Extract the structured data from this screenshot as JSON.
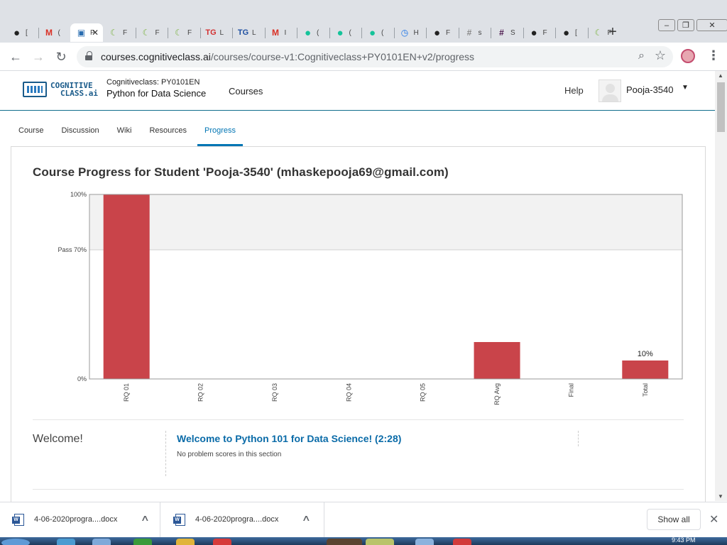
{
  "browser": {
    "tabs": [
      {
        "icon": "github-icon",
        "title": "[",
        "color": "#222"
      },
      {
        "icon": "gmail-icon",
        "title": "(",
        "color": "#d93025"
      },
      {
        "icon": "cognitiveclass-icon",
        "title": "P",
        "color": "#2a6db0",
        "active": true
      },
      {
        "icon": "moon-icon",
        "title": "F",
        "color": "#7cb342"
      },
      {
        "icon": "moon-icon",
        "title": "F",
        "color": "#7cb342"
      },
      {
        "icon": "moon-icon",
        "title": "F",
        "color": "#7cb342"
      },
      {
        "icon": "tg-icon",
        "title": "L",
        "color": "#d32f2f"
      },
      {
        "icon": "tg-icon",
        "title": "L",
        "color": "#1e4fa1"
      },
      {
        "icon": "gmail-icon",
        "title": "I",
        "color": "#d93025"
      },
      {
        "icon": "grammarly-icon",
        "title": "(",
        "color": "#15c39a"
      },
      {
        "icon": "grammarly-icon",
        "title": "(",
        "color": "#15c39a"
      },
      {
        "icon": "grammarly-icon",
        "title": "(",
        "color": "#15c39a"
      },
      {
        "icon": "history-icon",
        "title": "H",
        "color": "#1a73e8"
      },
      {
        "icon": "github-icon",
        "title": "F",
        "color": "#222"
      },
      {
        "icon": "slack-icon",
        "title": "s",
        "color": "#888"
      },
      {
        "icon": "slack-icon",
        "title": "S",
        "color": "#4a154b"
      },
      {
        "icon": "github-icon",
        "title": "F",
        "color": "#222"
      },
      {
        "icon": "github-icon",
        "title": "[",
        "color": "#222"
      },
      {
        "icon": "moon-icon",
        "title": "F",
        "color": "#7cb342"
      }
    ],
    "url_host": "courses.cognitiveclass.ai",
    "url_path": "/courses/course-v1:Cognitiveclass+PY0101EN+v2/progress"
  },
  "header": {
    "logo_line1": "COGNITIVE",
    "logo_line2": "CLASS.ai",
    "course_org": "Cognitiveclass: PY0101EN",
    "course_name": "Python for Data Science",
    "nav_courses": "Courses",
    "help": "Help",
    "username": "Pooja-3540"
  },
  "course_tabs": [
    {
      "label": "Course",
      "active": false
    },
    {
      "label": "Discussion",
      "active": false
    },
    {
      "label": "Wiki",
      "active": false
    },
    {
      "label": "Resources",
      "active": false
    },
    {
      "label": "Progress",
      "active": true
    }
  ],
  "main": {
    "title": "Course Progress for Student 'Pooja-3540' (mhaskepooja69@gmail.com)",
    "section_title": "Welcome!",
    "subsection_title": "Welcome to Python 101 for Data Science! (2:28)",
    "subsection_note": "No problem scores in this section"
  },
  "chart_data": {
    "type": "bar",
    "categories": [
      "RQ 01",
      "RQ 02",
      "RQ 03",
      "RQ 04",
      "RQ 05",
      "RQ Avg",
      "Final",
      "Total"
    ],
    "values": [
      100,
      0,
      0,
      0,
      0,
      20,
      0,
      10
    ],
    "data_labels": {
      "Total": "10%"
    },
    "ylim": [
      0,
      100
    ],
    "y_ticks": [
      {
        "value": 0,
        "label": "0%"
      },
      {
        "value": 70,
        "label": "Pass 70%"
      },
      {
        "value": 100,
        "label": "100%"
      }
    ],
    "pass_value": 70,
    "bar_color": "#c9444a",
    "pass_band_color": "#f2f2f2"
  },
  "downloads": {
    "items": [
      {
        "name": "4-06-2020progra....docx"
      },
      {
        "name": "4-06-2020progra....docx"
      }
    ],
    "show_all": "Show all"
  },
  "taskbar": {
    "clock": "9:43 PM"
  }
}
